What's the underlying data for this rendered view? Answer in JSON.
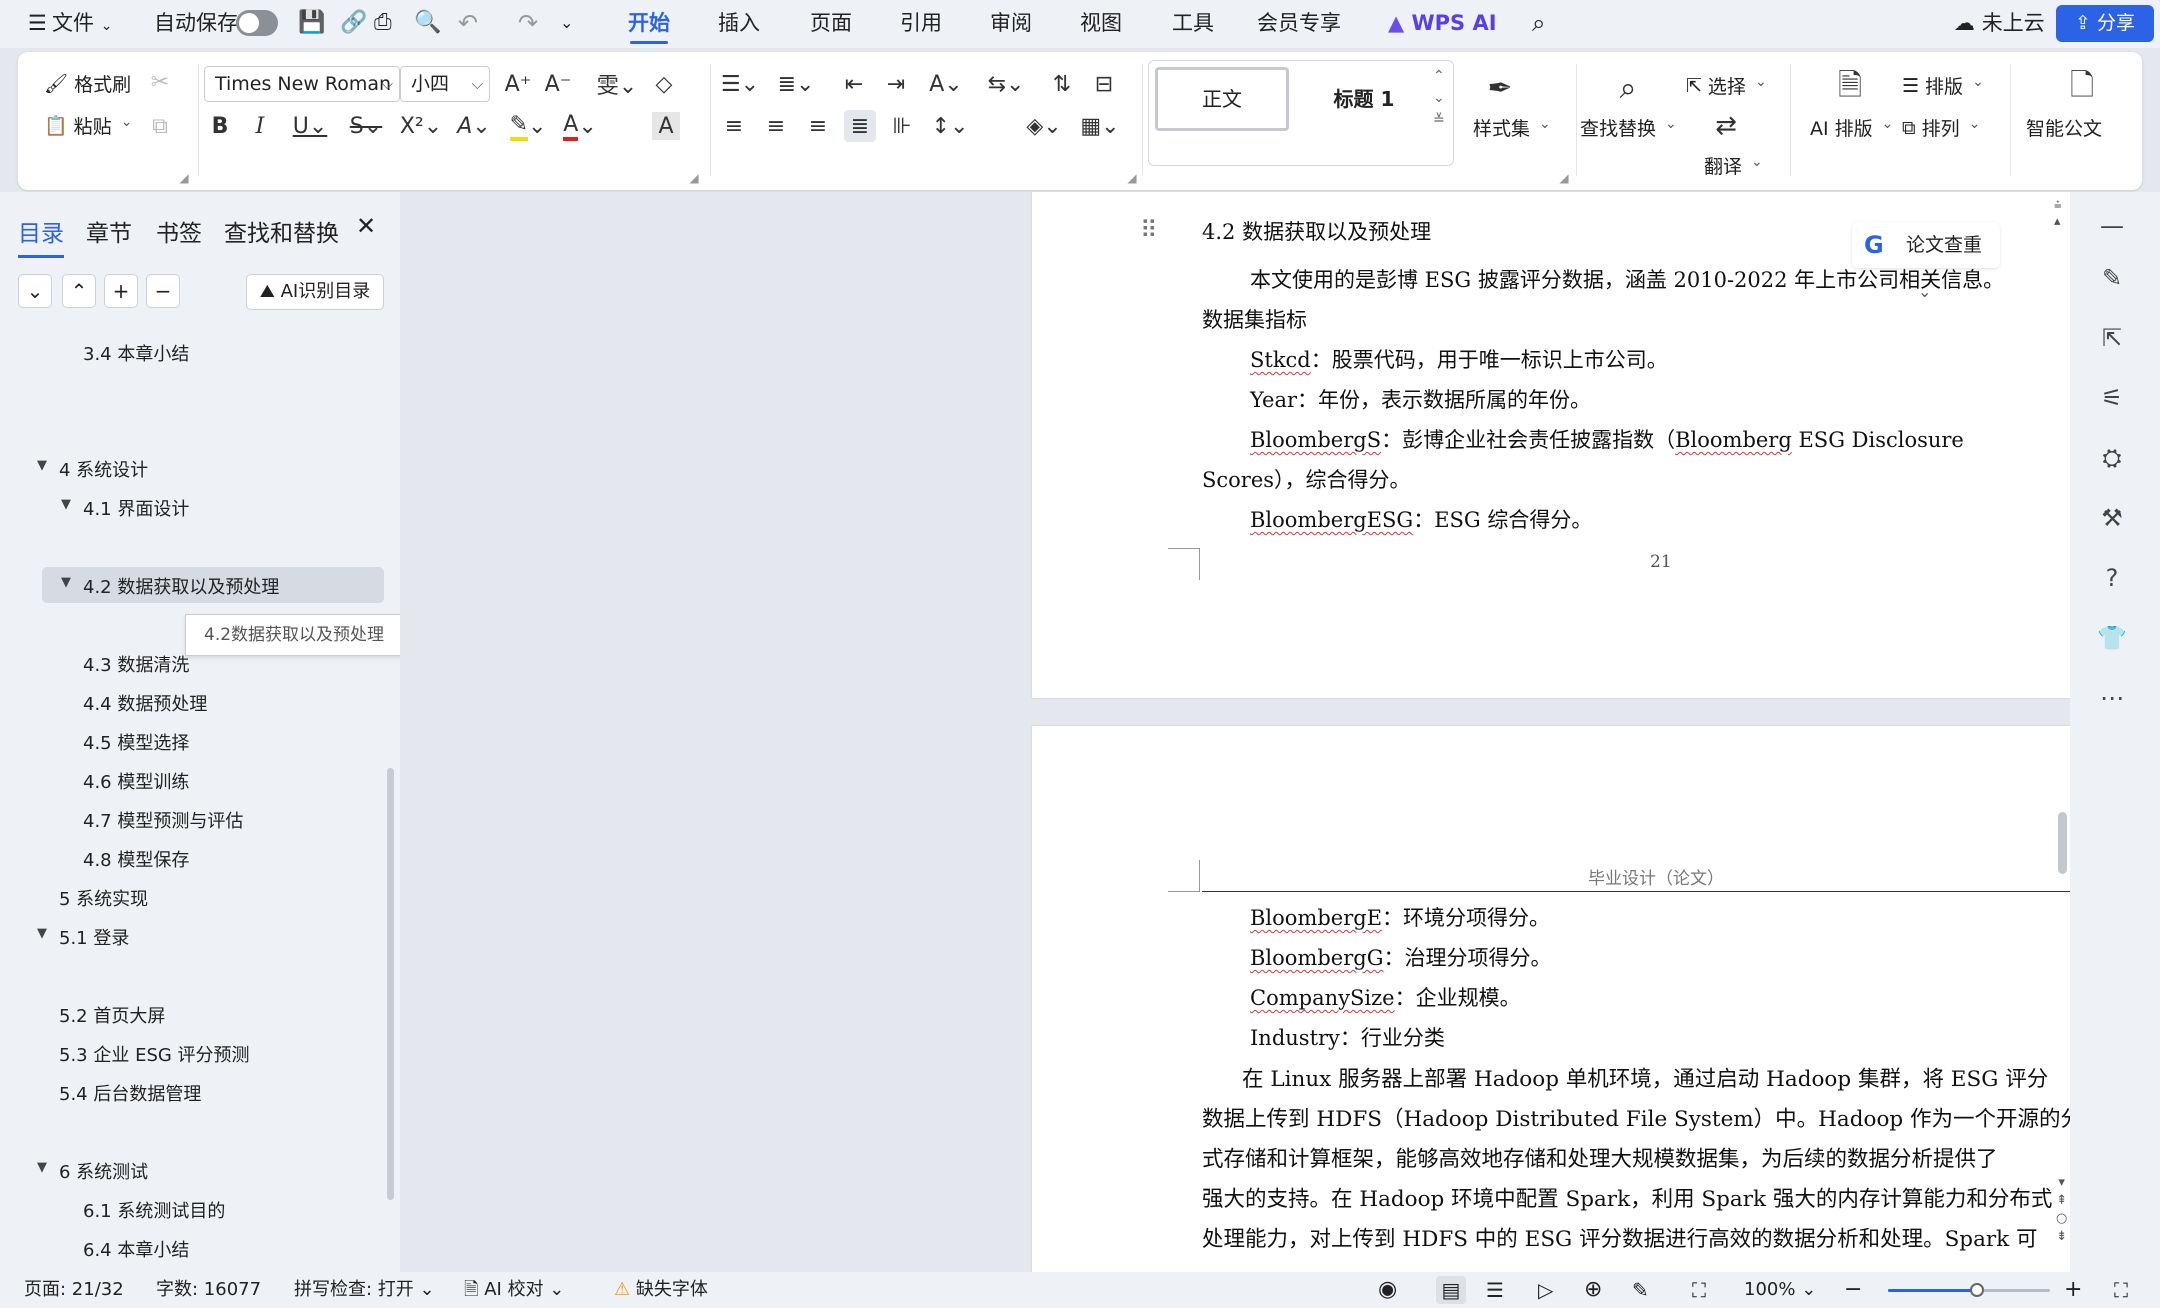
{
  "menubar": {
    "menu_icon": "hamburger-icon",
    "file": "文件",
    "autosave": "自动保存",
    "tabs": [
      "开始",
      "插入",
      "页面",
      "引用",
      "审阅",
      "视图",
      "工具",
      "会员专享"
    ],
    "active_tab": "开始",
    "wps_ai": "WPS AI",
    "cloud": "未上云",
    "share": "分享"
  },
  "ribbon": {
    "format_painter": "格式刷",
    "paste": "粘贴",
    "font_name": "Times New Roman",
    "font_size": "小四",
    "style_normal": "正文",
    "style_heading": "标题 1",
    "style_set": "样式集",
    "find_replace": "查找替换",
    "select": "选择",
    "translate": "翻译",
    "ai_layout": "AI 排版",
    "typeset": "排版",
    "arrange": "排列",
    "smart_doc": "智能公文",
    "font_color": "#e02020",
    "highlight_color": "#f5d90a"
  },
  "sidebar": {
    "tabs": [
      "目录",
      "章节",
      "书签",
      "查找和替换"
    ],
    "ai_toc": "AI识别目录",
    "toc": [
      {
        "label": "3.4 本章小结"
      },
      {
        "label": "4  系统设计"
      },
      {
        "label": "4.1  界面设计"
      },
      {
        "label": "4.2 数据获取以及预处理"
      },
      {
        "label": "4.3 数据清洗"
      },
      {
        "label": "4.4  数据预处理"
      },
      {
        "label": "4.5  模型选择"
      },
      {
        "label": "4.6  模型训练"
      },
      {
        "label": "4.7  模型预测与评估"
      },
      {
        "label": "4.8  模型保存"
      },
      {
        "label": "5 系统实现"
      },
      {
        "label": "5.1  登录"
      },
      {
        "label": "5.2  首页大屏"
      },
      {
        "label": "5.3  企业 ESG 评分预测"
      },
      {
        "label": "5.4  后台数据管理"
      },
      {
        "label": "6  系统测试"
      },
      {
        "label": "6.1  系统测试目的"
      },
      {
        "label": "6.4  本章小结"
      }
    ],
    "tooltip": "4.2数据获取以及预处理"
  },
  "page1": {
    "heading": "4.2 数据获取以及预处理",
    "p1_line1": "本文使用的是彭博 ESG 披露评分数据，涵盖 2010-2022 年上市公司相关信息。",
    "p1_line2": "数据集指标",
    "f1_term": "Stkcd",
    "f1_desc": "：股票代码，用于唯一标识上市公司。",
    "f2": "Year：年份，表示数据所属的年份。",
    "f3_term": "BloombergS",
    "f3_desc_a": "：彭博企业社会责任披露指数（",
    "f3_desc_term": "Bloomberg",
    "f3_desc_b": " ESG Disclosure",
    "f3_line2": "Scores），综合得分。",
    "f4_term": "BloombergESG",
    "f4_desc": "：ESG 综合得分。",
    "page_number": "21"
  },
  "page2": {
    "header": "毕业设计（论文）",
    "f5_term": "BloombergE",
    "f5_desc": "：环境分项得分。",
    "f6_term": "BloombergG",
    "f6_desc": "：治理分项得分。",
    "f7_term": "CompanySize",
    "f7_desc": "：企业规模。",
    "f8": "Industry：行业分类",
    "body": [
      "在 Linux 服务器上部署 Hadoop 单机环境，通过启动 Hadoop 集群，将 ESG 评分",
      "数据上传到 HDFS（Hadoop Distributed File System）中。Hadoop 作为一个开源的分布",
      "式存储和计算框架，能够高效地存储和处理大规模数据集，为后续的数据分析提供了",
      "强大的支持。在 Hadoop 环境中配置 Spark，利用 Spark 强大的内存计算能力和分布式",
      "处理能力，对上传到 HDFS 中的 ESG 评分数据进行高效的数据分析和处理。Spark 可"
    ]
  },
  "right_panel": {
    "paper_check": "论文查重"
  },
  "statusbar": {
    "page": "页面: 21/32",
    "words": "字数: 16077",
    "spell": "拼写检查: 打开",
    "ai_check": "AI 校对",
    "missing_font": "缺失字体",
    "zoom": "100%",
    "zoom_level": 0.55
  }
}
